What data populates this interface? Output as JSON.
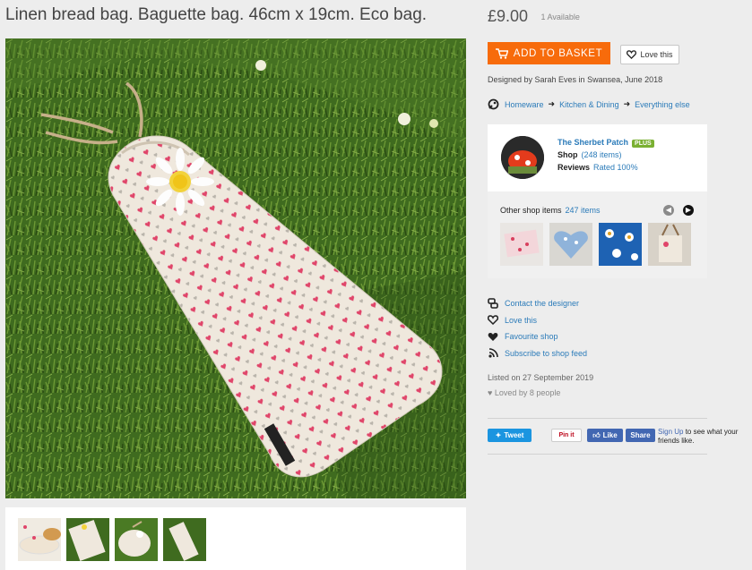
{
  "product": {
    "title": "Linen bread bag. Baguette bag. 46cm x 19cm. Eco bag.",
    "price": "£9.00",
    "availability": "1 Available",
    "add_to_basket": "ADD TO BASKET",
    "love_this": "Love this",
    "designed_by": "Designed by Sarah Eves in Swansea, June 2018"
  },
  "categories": [
    "Homeware",
    "Kitchen & Dining",
    "Everything else"
  ],
  "shop": {
    "name": "The Sherbet Patch",
    "badge": "PLUS",
    "shop_label": "Shop",
    "shop_value": "(248 items)",
    "reviews_label": "Reviews",
    "reviews_value": "Rated 100%",
    "other_items_label": "Other shop items",
    "other_items_count": "247 items"
  },
  "actions": [
    {
      "label": "Contact the designer",
      "icon": "chat-icon"
    },
    {
      "label": "Love this",
      "icon": "heart-outline-icon"
    },
    {
      "label": "Favourite shop",
      "icon": "heart-filled-icon"
    },
    {
      "label": "Subscribe to shop feed",
      "icon": "rss-icon"
    }
  ],
  "listed": "Listed on 27 September 2019",
  "loved_by": "Loved by 8 people",
  "social": {
    "tweet": "Tweet",
    "pin": "Pin it",
    "like": "Like",
    "share": "Share",
    "signup_link": "Sign Up",
    "signup_text": " to see what your friends like."
  },
  "colors": {
    "accent": "#f76b0b",
    "link": "#2b7bb9",
    "plus_badge": "#7ab032",
    "twitter": "#1b95e0",
    "facebook": "#4267b2"
  }
}
